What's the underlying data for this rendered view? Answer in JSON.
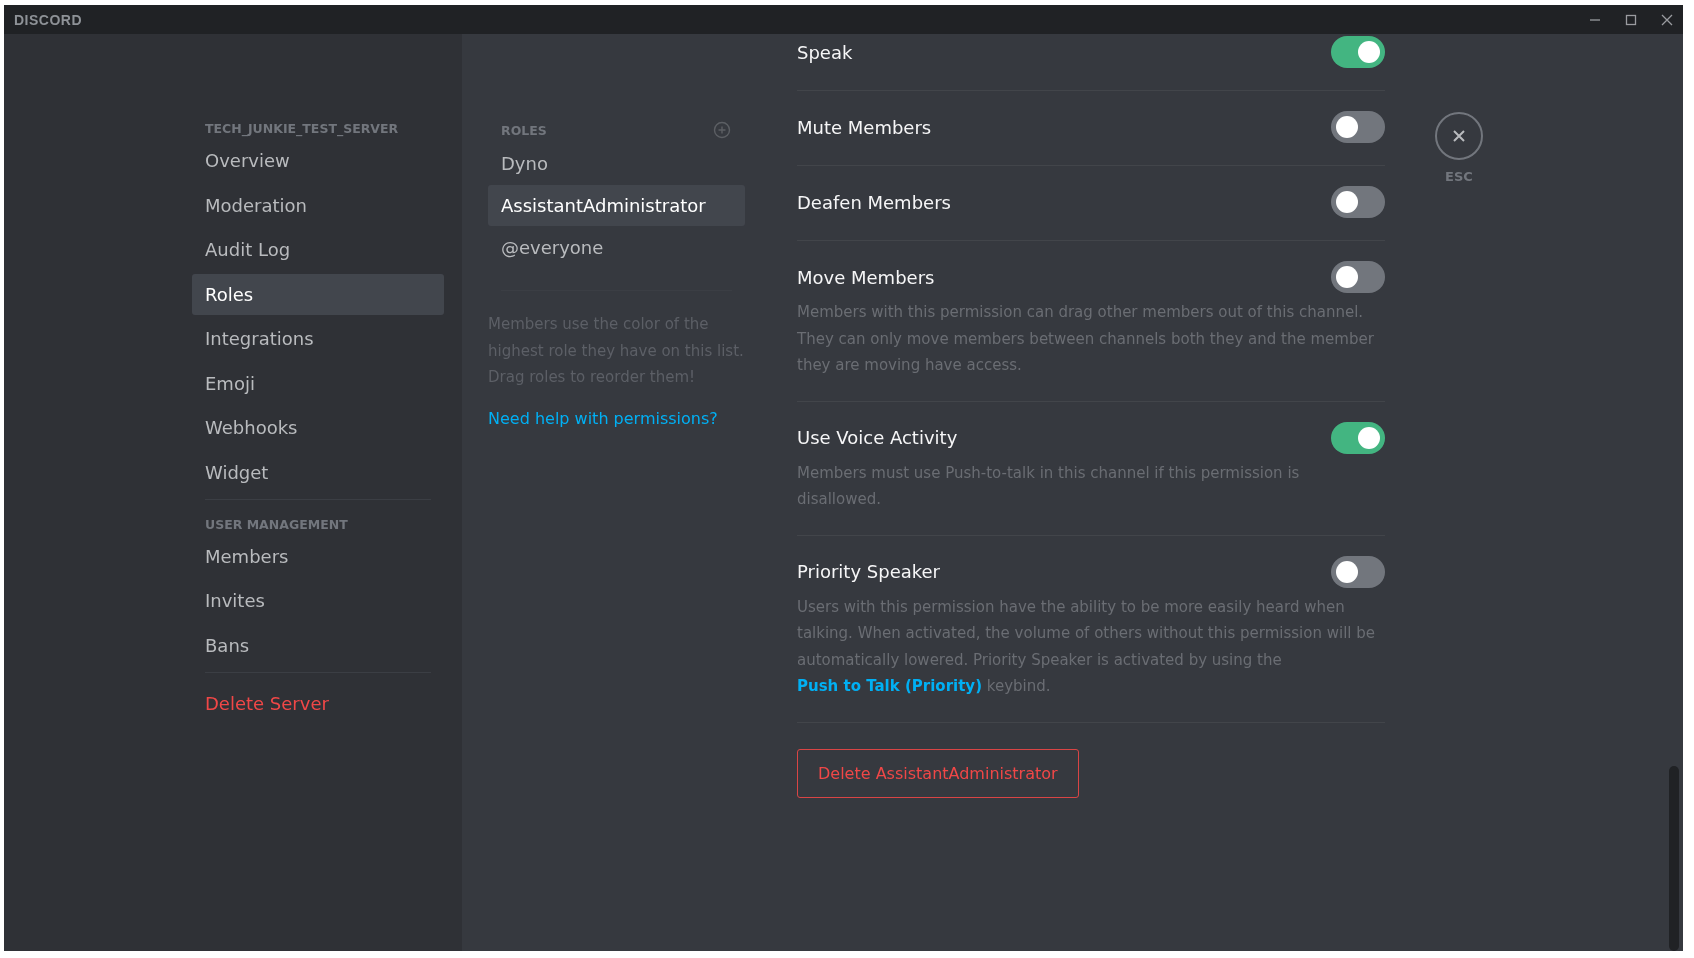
{
  "window": {
    "title": "DISCORD"
  },
  "sidebar": {
    "sections": [
      {
        "header": "TECH_JUNKIE_TEST_SERVER",
        "items": [
          {
            "label": "Overview",
            "selected": false
          },
          {
            "label": "Moderation",
            "selected": false
          },
          {
            "label": "Audit Log",
            "selected": false
          },
          {
            "label": "Roles",
            "selected": true
          },
          {
            "label": "Integrations",
            "selected": false
          },
          {
            "label": "Emoji",
            "selected": false
          },
          {
            "label": "Webhooks",
            "selected": false
          },
          {
            "label": "Widget",
            "selected": false
          }
        ]
      },
      {
        "header": "USER MANAGEMENT",
        "items": [
          {
            "label": "Members",
            "selected": false
          },
          {
            "label": "Invites",
            "selected": false
          },
          {
            "label": "Bans",
            "selected": false
          }
        ]
      }
    ],
    "danger_item": "Delete Server"
  },
  "roles": {
    "header": "ROLES",
    "items": [
      {
        "label": "Dyno",
        "selected": false
      },
      {
        "label": "AssistantAdministrator",
        "selected": true
      },
      {
        "label": "@everyone",
        "selected": false
      }
    ],
    "hint": "Members use the color of the highest role they have on this list. Drag roles to reorder them!",
    "help_link": "Need help with permissions?"
  },
  "permissions": [
    {
      "title": "Speak",
      "on": true
    },
    {
      "title": "Mute Members",
      "on": false
    },
    {
      "title": "Deafen Members",
      "on": false
    },
    {
      "title": "Move Members",
      "on": false,
      "description": [
        {
          "kind": "text",
          "text": "Members with this permission can drag other members out of this channel. They can only move members between channels both they and the member they are moving have access."
        }
      ]
    },
    {
      "title": "Use Voice Activity",
      "on": true,
      "description": [
        {
          "kind": "text",
          "text": "Members must use Push-to-talk in this channel if this permission is disallowed."
        }
      ]
    },
    {
      "title": "Priority Speaker",
      "on": false,
      "description": [
        {
          "kind": "text",
          "text": "Users with this permission have the ability to be more easily heard when talking. When activated, the volume of others without this permission will be automatically lowered. Priority Speaker is activated by using the "
        },
        {
          "kind": "link",
          "text": "Push to Talk (Priority)"
        },
        {
          "kind": "text",
          "text": " keybind."
        }
      ]
    }
  ],
  "delete_button": "Delete AssistantAdministrator",
  "close": {
    "label": "ESC"
  }
}
